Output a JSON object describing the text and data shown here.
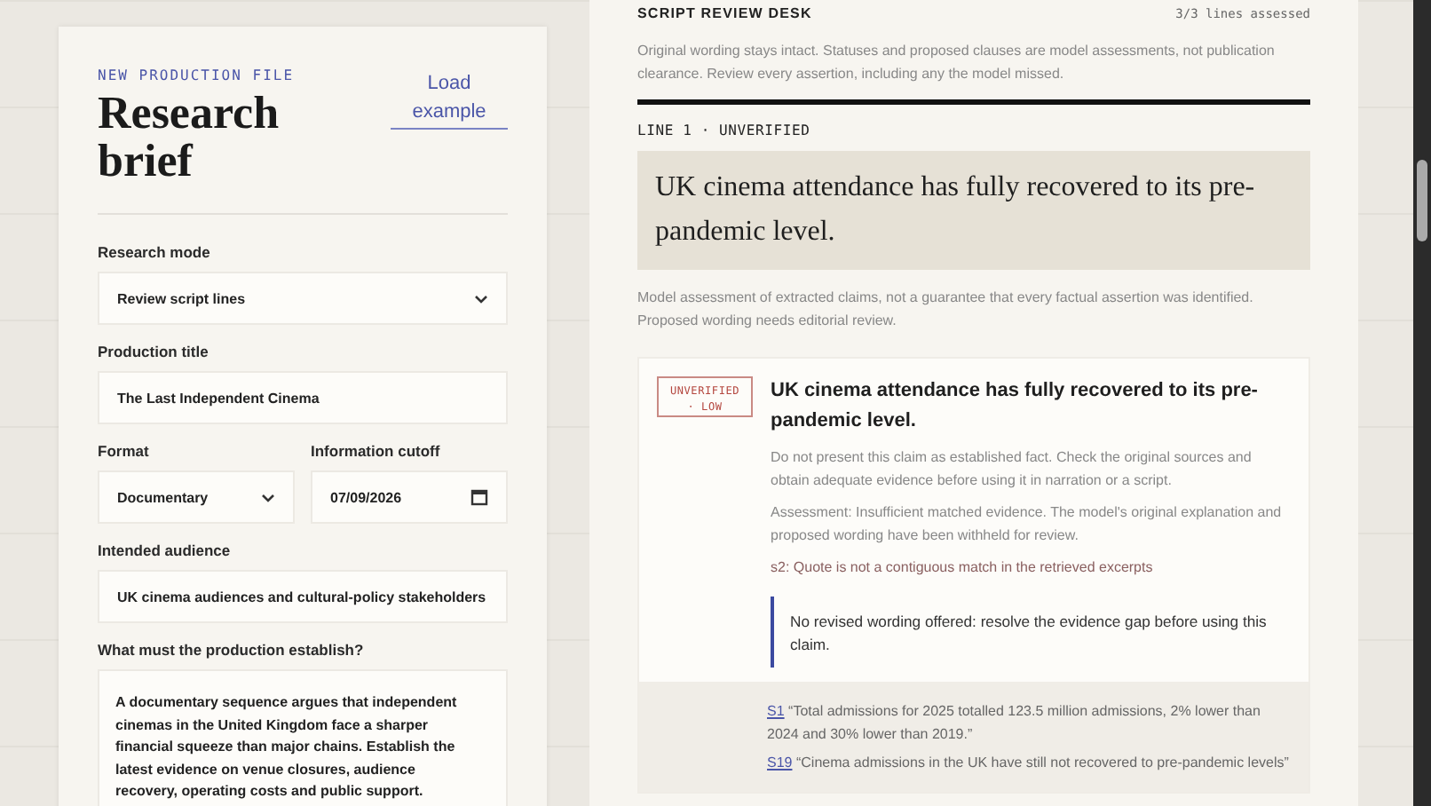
{
  "brief": {
    "eyebrow": "NEW PRODUCTION FILE",
    "title": "Research brief",
    "load_example": "Load example",
    "fields": [
      {
        "kind": "select",
        "label": "Research mode",
        "value": "Review script lines"
      },
      {
        "kind": "text",
        "label": "Production title",
        "value": "The Last Independent Cinema"
      },
      {
        "kind": "row",
        "fields": [
          {
            "kind": "select",
            "label": "Format",
            "value": "Documentary"
          },
          {
            "kind": "date",
            "label": "Information cutoff",
            "value": "07/09/2026"
          }
        ]
      },
      {
        "kind": "text",
        "label": "Intended audience",
        "value": "UK cinema audiences and cultural-policy stakeholders"
      },
      {
        "kind": "textarea",
        "label": "What must the production establish?",
        "value": "A documentary sequence argues that independent cinemas in the United Kingdom face a sharper financial squeeze than major chains. Establish the latest evidence on venue closures, audience recovery, operating costs and public support."
      }
    ]
  },
  "review": {
    "title": "SCRIPT REVIEW DESK",
    "progress": "3/3 lines assessed",
    "intro": "Original wording stays intact. Statuses and proposed clauses are model assessments, not publication clearance. Review every assertion, including any the model missed.",
    "line_label": "LINE 1 · UNVERIFIED",
    "line_text": "UK cinema attendance has fully recovered to its pre-pandemic level.",
    "disclaimer": "Model assessment of extracted claims, not a guarantee that every factual assertion was identified. Proposed wording needs editorial review.",
    "claims": [
      {
        "badge": "UNVERIFIED · LOW",
        "heading": "UK cinema attendance has fully recovered to its pre-pandemic level.",
        "advice": "Do not present this claim as established fact. Check the original sources and obtain adequate evidence before using it in narration or a script.",
        "assessment": "Assessment: Insufficient matched evidence. The model's original explanation and proposed wording have been withheld for review.",
        "warning": "s2: Quote is not a contiguous match in the retrieved excerpts",
        "revision": "No revised wording offered: resolve the evidence gap before using this claim.",
        "evidence": [
          {
            "source": "S1",
            "quote": "“Total admissions for 2025 totalled 123.5 million admissions, 2% lower than 2024 and 30% lower than 2019.”"
          },
          {
            "source": "S19",
            "quote": "“Cinema admissions in the UK have still not recovered to pre-pandemic levels”"
          }
        ]
      }
    ]
  }
}
